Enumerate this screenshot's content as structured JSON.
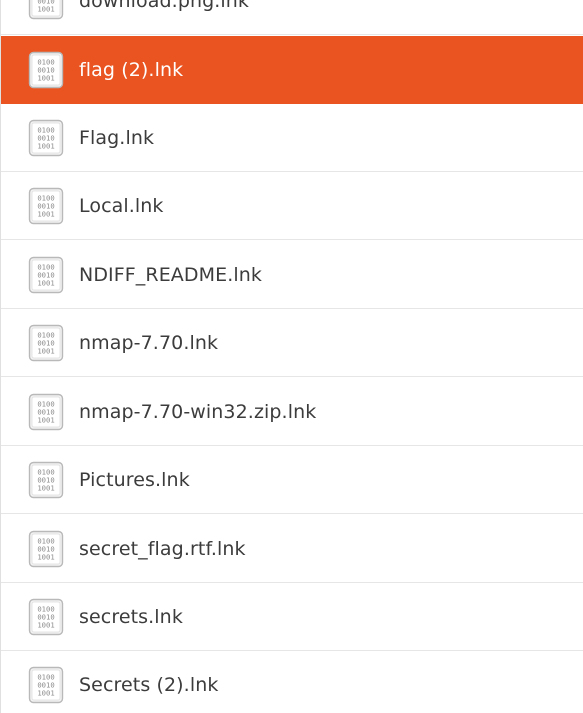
{
  "file_list": {
    "colors": {
      "selected_bg": "#e95420",
      "text": "#3c3c3c",
      "selected_text": "#ffffff"
    },
    "file_icon": "binary-file-icon",
    "items": [
      {
        "label": "download.png.lnk",
        "selected": false
      },
      {
        "label": "flag (2).lnk",
        "selected": true
      },
      {
        "label": "Flag.lnk",
        "selected": false
      },
      {
        "label": "Local.lnk",
        "selected": false
      },
      {
        "label": "NDIFF_README.lnk",
        "selected": false
      },
      {
        "label": "nmap-7.70.lnk",
        "selected": false
      },
      {
        "label": "nmap-7.70-win32.zip.lnk",
        "selected": false
      },
      {
        "label": "Pictures.lnk",
        "selected": false
      },
      {
        "label": "secret_flag.rtf.lnk",
        "selected": false
      },
      {
        "label": "secrets.lnk",
        "selected": false
      },
      {
        "label": "Secrets (2).lnk",
        "selected": false
      }
    ]
  }
}
